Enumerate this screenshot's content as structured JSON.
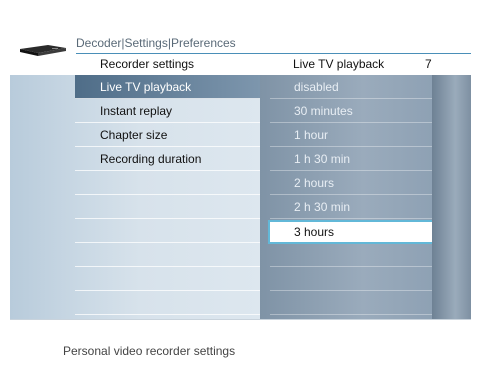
{
  "breadcrumb": {
    "items": [
      "Decoder",
      "Settings",
      "Preferences"
    ],
    "separator": "|"
  },
  "header": {
    "left": "Recorder settings",
    "right": "Live TV playback",
    "number": "7"
  },
  "menu": {
    "items": [
      {
        "label": "Live TV playback",
        "selected": true
      },
      {
        "label": "Instant replay"
      },
      {
        "label": "Chapter size"
      },
      {
        "label": "Recording duration"
      },
      {
        "label": ""
      },
      {
        "label": ""
      },
      {
        "label": ""
      },
      {
        "label": ""
      },
      {
        "label": ""
      },
      {
        "label": ""
      }
    ]
  },
  "options": {
    "items": [
      {
        "label": "disabled"
      },
      {
        "label": "30 minutes"
      },
      {
        "label": "1 hour"
      },
      {
        "label": "1 h 30 min"
      },
      {
        "label": "2 hours"
      },
      {
        "label": "2 h 30 min"
      },
      {
        "label": "3 hours",
        "selected": true
      },
      {
        "label": ""
      },
      {
        "label": ""
      },
      {
        "label": ""
      }
    ]
  },
  "footer": {
    "text": "Personal video recorder settings"
  },
  "colors": {
    "accent": "#4a8fb8",
    "selected_row": "#4f6d88",
    "highlight_border": "#62b8d8"
  },
  "icons": {
    "device": "set-top-box-icon"
  }
}
